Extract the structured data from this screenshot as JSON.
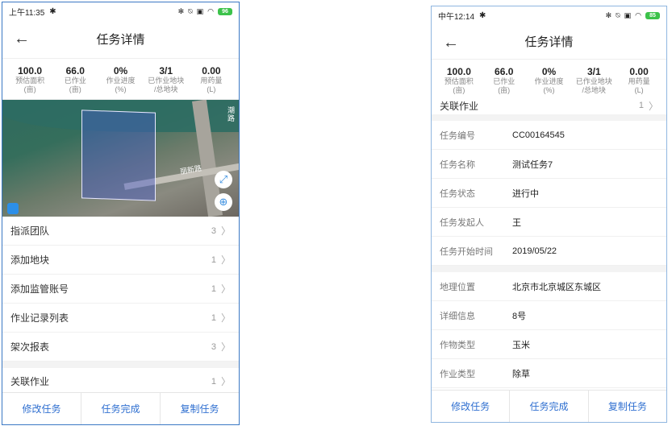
{
  "screen1": {
    "status": {
      "time": "上午11:35",
      "battery": "96"
    },
    "nav": {
      "back": "←",
      "title": "任务详情"
    },
    "stats": [
      {
        "value": "100.0",
        "label": "预估面积\n(亩)"
      },
      {
        "value": "66.0",
        "label": "已作业\n(亩)"
      },
      {
        "value": "0%",
        "label": "作业进度\n(%)"
      },
      {
        "value": "3/1",
        "label": "已作业地块\n/总地块"
      },
      {
        "value": "0.00",
        "label": "用药量\n(L)"
      }
    ],
    "map": {
      "road_label": "丽新路",
      "corner_label": "潮路",
      "expand_icon": "⤢",
      "locate_icon": "⊕"
    },
    "rows": [
      {
        "label": "指派团队",
        "count": "3"
      },
      {
        "label": "添加地块",
        "count": "1"
      },
      {
        "label": "添加监管账号",
        "count": "1"
      },
      {
        "label": "作业记录列表",
        "count": "1"
      },
      {
        "label": "架次报表",
        "count": "3"
      }
    ],
    "related": {
      "label": "关联作业",
      "count": "1"
    },
    "buttons": {
      "modify": "修改任务",
      "complete": "任务完成",
      "copy": "复制任务"
    }
  },
  "screen2": {
    "status": {
      "time": "中午12:14",
      "battery": "85"
    },
    "nav": {
      "back": "←",
      "title": "任务详情"
    },
    "stats": [
      {
        "value": "100.0",
        "label": "预估面积\n(亩)"
      },
      {
        "value": "66.0",
        "label": "已作业\n(亩)"
      },
      {
        "value": "0%",
        "label": "作业进度\n(%)"
      },
      {
        "value": "3/1",
        "label": "已作业地块\n/总地块"
      },
      {
        "value": "0.00",
        "label": "用药量\n(L)"
      }
    ],
    "related": {
      "label": "关联作业",
      "count": "1"
    },
    "group1": [
      {
        "key": "任务编号",
        "value": "CC00164545"
      },
      {
        "key": "任务名称",
        "value": "测试任务7"
      },
      {
        "key": "任务状态",
        "value": "进行中"
      },
      {
        "key": "任务发起人",
        "value": "王"
      },
      {
        "key": "任务开始时间",
        "value": "2019/05/22"
      }
    ],
    "group2": [
      {
        "key": "地理位置",
        "value": "北京市北京城区东城区"
      },
      {
        "key": "详细信息",
        "value": "8号"
      },
      {
        "key": "作物类型",
        "value": "玉米"
      },
      {
        "key": "作业类型",
        "value": "除草"
      }
    ],
    "buttons": {
      "modify": "修改任务",
      "complete": "任务完成",
      "copy": "复制任务"
    }
  }
}
